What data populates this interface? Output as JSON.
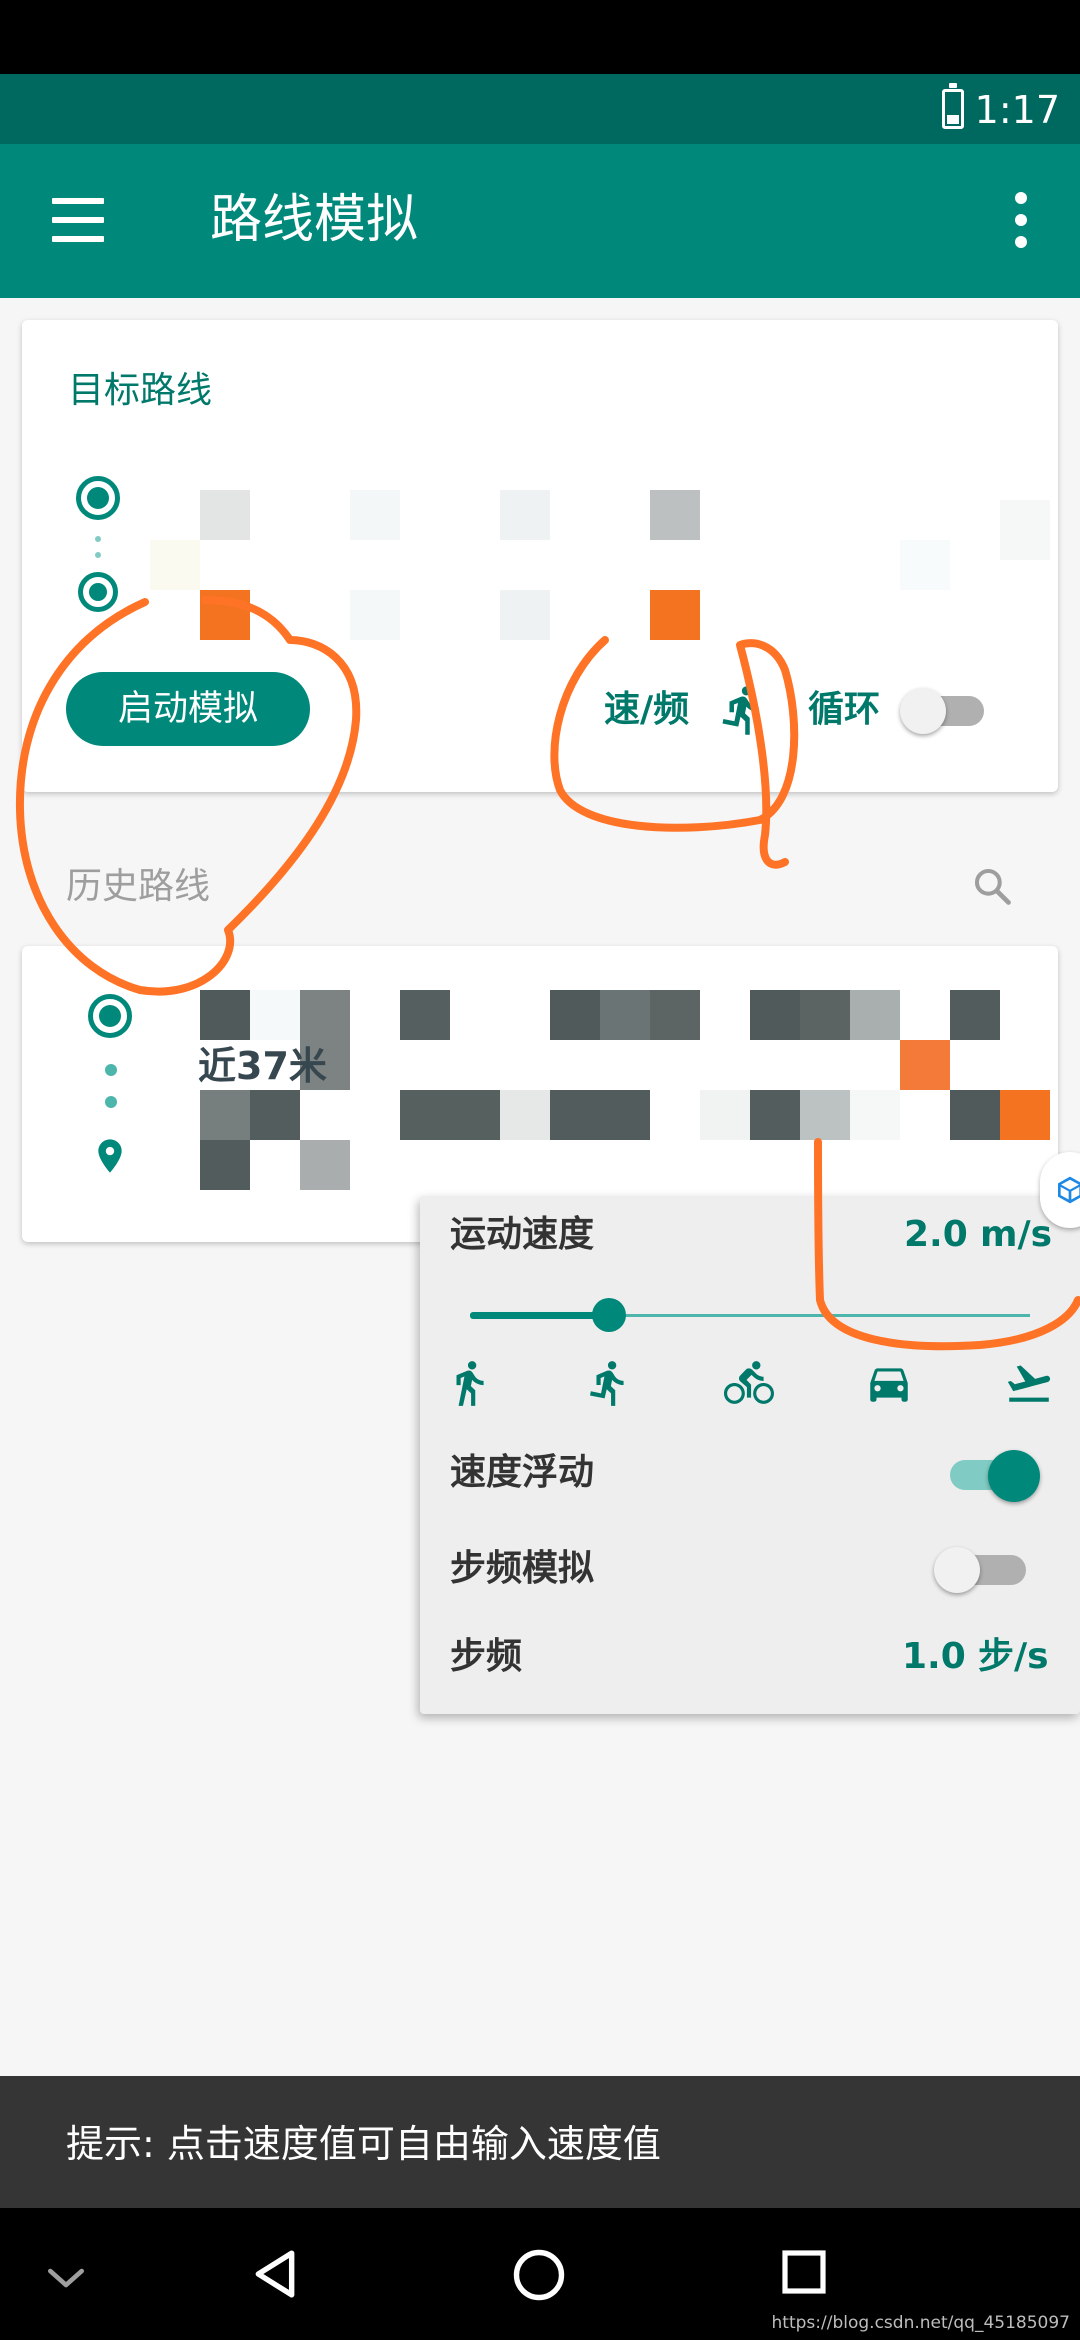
{
  "status_bar": {
    "time": "1:17",
    "battery_icon": "battery-icon"
  },
  "app_bar": {
    "title": "路线模拟",
    "menu_icon": "menu-icon",
    "more_icon": "more-vert-icon"
  },
  "target_route": {
    "label": "目标路线",
    "start_button": "启动模拟",
    "speed_freq_label": "速/频",
    "loop_label": "循环",
    "loop_enabled": false
  },
  "history_route": {
    "label": "历史路线",
    "item_distance": "近37米"
  },
  "speed_panel": {
    "speed_label": "运动速度",
    "speed_value": "2.0",
    "speed_unit": "m/s",
    "slider_fraction": 0.18,
    "modes": [
      "walk-icon",
      "run-icon",
      "bike-icon",
      "car-icon",
      "plane-icon"
    ],
    "speed_float_label": "速度浮动",
    "speed_float_enabled": true,
    "step_sim_label": "步频模拟",
    "step_sim_enabled": false,
    "step_freq_label": "步频",
    "step_freq_value": "1.0",
    "step_freq_unit": "步/s"
  },
  "toast": {
    "text": "提示: 点击速度值可自由输入速度值"
  },
  "watermark": "https://blog.csdn.net/qq_45185097",
  "colors": {
    "primary": "#00897b",
    "primary_dark": "#00695f",
    "annotation": "#ff7326"
  }
}
